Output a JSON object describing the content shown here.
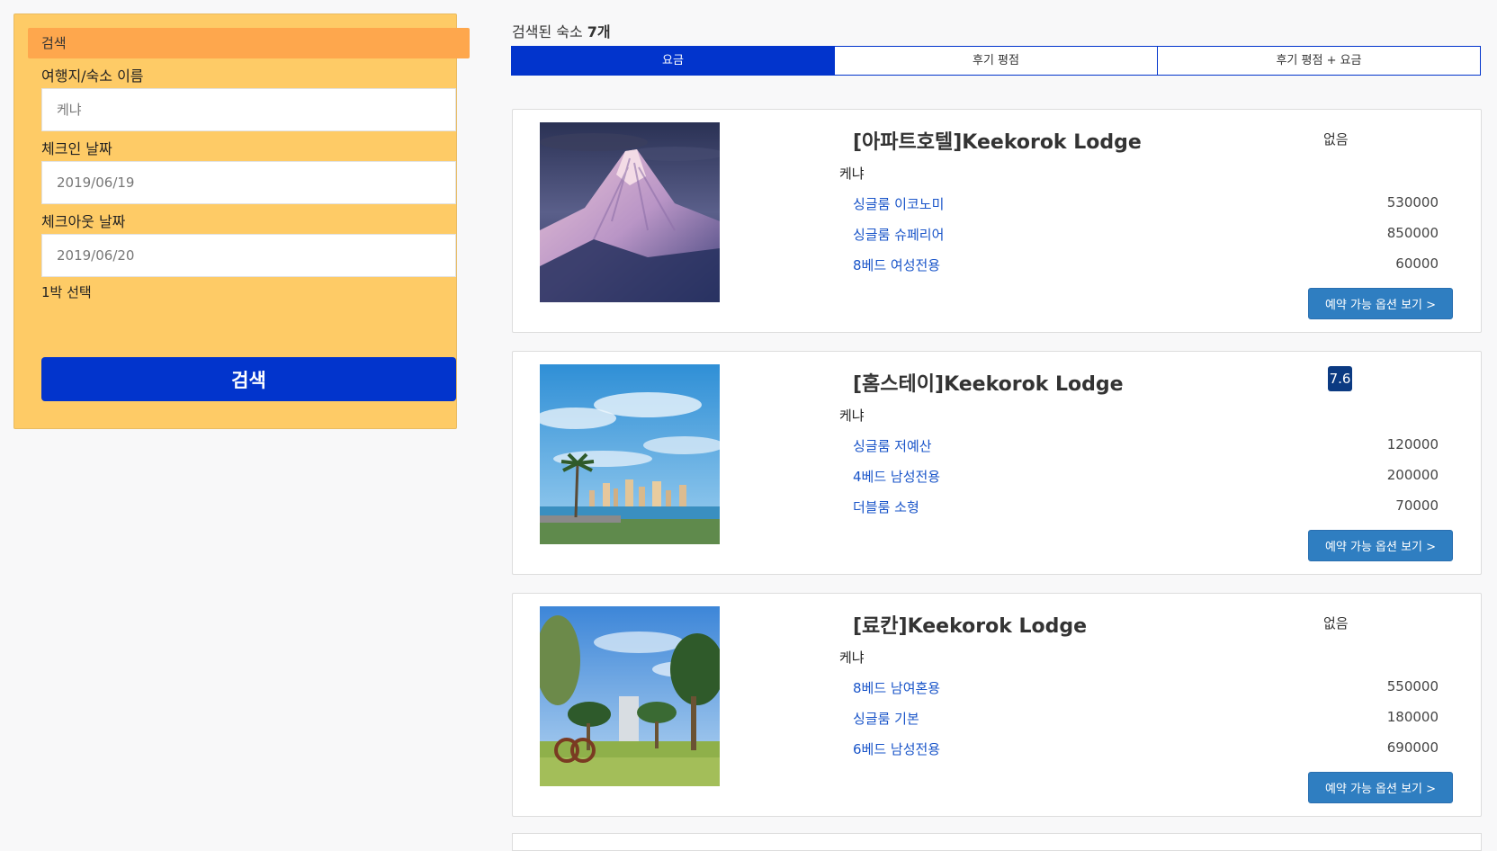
{
  "sidebar": {
    "header": "검색",
    "destination_label": "여행지/숙소 이름",
    "destination_value": "케냐",
    "checkin_label": "체크인 날짜",
    "checkin_value": "2019/06/19",
    "checkout_label": "체크아웃 날짜",
    "checkout_value": "2019/06/20",
    "nights_text": "1박 선택",
    "search_button": "검색"
  },
  "results": {
    "count_prefix": "검색된 숙소 ",
    "count_value": "7개",
    "sort_tabs": [
      {
        "label": "요금",
        "active": true
      },
      {
        "label": "후기 평점",
        "active": false
      },
      {
        "label": "후기 평점 + 요금",
        "active": false
      }
    ],
    "option_button_label": "예약 가능 옵션 보기 >"
  },
  "hotels": [
    {
      "name": "[아파트호텔]Keekorok Lodge",
      "rating": "없음",
      "has_score": false,
      "location": "케냐",
      "image": "snow-mountain-photo",
      "rooms": [
        {
          "name": "싱글룸 이코노미",
          "price": "530000"
        },
        {
          "name": "싱글룸 슈페리어",
          "price": "850000"
        },
        {
          "name": "8베드 여성전용",
          "price": "60000"
        }
      ]
    },
    {
      "name": "[홈스테이]Keekorok Lodge",
      "rating": "7.6",
      "has_score": true,
      "location": "케냐",
      "image": "city-skyline-photo",
      "rooms": [
        {
          "name": "싱글룸 저예산",
          "price": "120000"
        },
        {
          "name": "4베드 남성전용",
          "price": "200000"
        },
        {
          "name": "더블룸 소형",
          "price": "70000"
        }
      ]
    },
    {
      "name": "[료칸]Keekorok Lodge",
      "rating": "없음",
      "has_score": false,
      "location": "케냐",
      "image": "park-trees-photo",
      "rooms": [
        {
          "name": "8베드 남여혼용",
          "price": "550000"
        },
        {
          "name": "싱글룸 기본",
          "price": "180000"
        },
        {
          "name": "6베드 남성전용",
          "price": "690000"
        }
      ]
    }
  ],
  "colors": {
    "accent": "#0234cc",
    "sidebar_bg": "#fecb66",
    "sidebar_header": "#fea74d",
    "link": "#1a55c9",
    "option_button": "#2f7ec1",
    "score_badge": "#0b3a82"
  }
}
